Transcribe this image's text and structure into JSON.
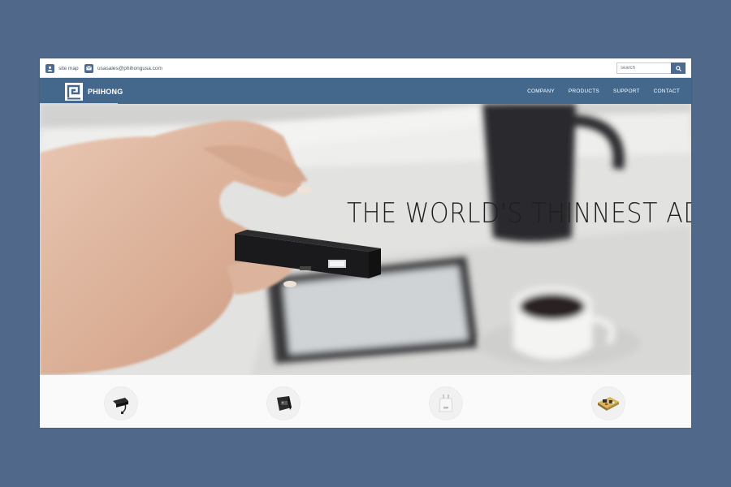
{
  "colors": {
    "page_background": "#50698a",
    "nav_background": "#44688c",
    "accent": "#4c6a8f",
    "nav_text": "#ffffff"
  },
  "utility_bar": {
    "items": [
      {
        "label": "site map",
        "icon": "person-icon"
      },
      {
        "label": "usasales@phihongusa.com",
        "icon": "mail-icon"
      }
    ],
    "search": {
      "placeholder": "search",
      "button_icon": "magnifier-icon"
    }
  },
  "navbar": {
    "brand": "PHIHONG",
    "logo_icon": "phihong-logo",
    "links": [
      "COMPANY",
      "PRODUCTS",
      "SUPPORT",
      "CONTACT"
    ]
  },
  "hero": {
    "headline": "THE WORLD'S THINNEST ADAPTER",
    "image_description_icons": [
      "hand-holding-adapter",
      "tablet",
      "coffee-cup",
      "coffee-pot"
    ]
  },
  "products": {
    "thumbnails": [
      {
        "icon": "desktop-adapter-icon"
      },
      {
        "icon": "wall-adapter-icon"
      },
      {
        "icon": "usb-charger-icon"
      },
      {
        "icon": "power-module-icon"
      }
    ]
  }
}
